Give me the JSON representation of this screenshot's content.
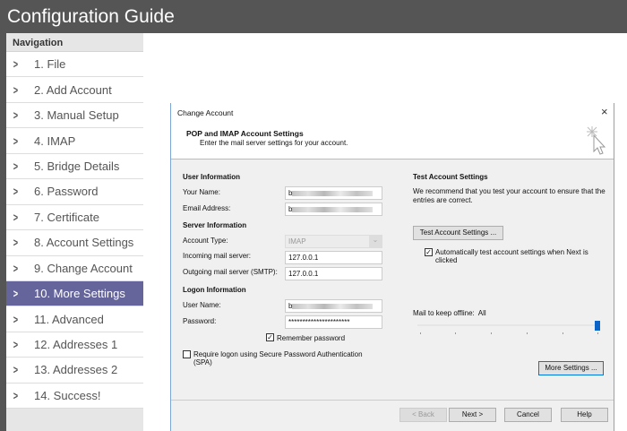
{
  "header": {
    "title": "Configuration Guide"
  },
  "nav": {
    "title": "Navigation",
    "items": [
      "1. File",
      "2. Add Account",
      "3. Manual Setup",
      "4. IMAP",
      "5. Bridge Details",
      "6. Password",
      "7. Certificate",
      "8. Account Settings",
      "9. Change Account",
      "10. More Settings",
      "11. Advanced",
      "12. Addresses 1",
      "13. Addresses 2",
      "14. Success!"
    ],
    "active_index": 9
  },
  "dialog": {
    "title": "Change Account",
    "close": "×",
    "heading": "POP and IMAP Account Settings",
    "subheading": "Enter the mail server settings for your account.",
    "user_info": "User Information",
    "your_name_label": "Your Name:",
    "your_name_value": "b",
    "email_label": "Email Address:",
    "email_value": "b",
    "server_info": "Server Information",
    "account_type_label": "Account Type:",
    "account_type_value": "IMAP",
    "incoming_label": "Incoming mail server:",
    "incoming_value": "127.0.0.1",
    "outgoing_label": "Outgoing mail server (SMTP):",
    "outgoing_value": "127.0.0.1",
    "logon_info": "Logon Information",
    "username_label": "User Name:",
    "username_value": "b",
    "password_label": "Password:",
    "password_value": "**********************",
    "remember_password": "Remember password",
    "remember_checked": true,
    "spa": "Require logon using Secure Password Authentication (SPA)",
    "spa_checked": false,
    "test_heading": "Test Account Settings",
    "test_text": "We recommend that you test your account to ensure that the entries are correct.",
    "test_button": "Test Account Settings ...",
    "auto_test": "Automatically test account settings when Next is clicked",
    "auto_test_checked": true,
    "offline_label": "Mail to keep offline:",
    "offline_value": "All",
    "offline_slider_fraction": 1.0,
    "more_settings": "More Settings ...",
    "back": "< Back",
    "next": "Next >",
    "cancel": "Cancel",
    "help": "Help"
  }
}
